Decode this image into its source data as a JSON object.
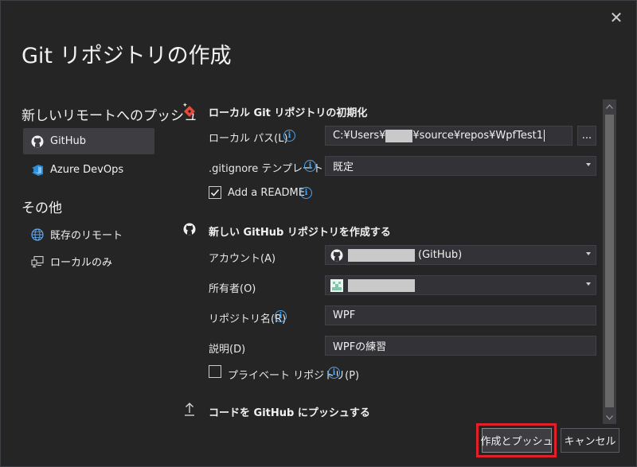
{
  "window": {
    "title": "Git リポジトリの作成",
    "close_glyph": "✕"
  },
  "sidebar": {
    "heading_push": "新しいリモートへのプッシュ",
    "items": [
      {
        "label": "GitHub",
        "icon": "github-icon",
        "selected": true
      },
      {
        "label": "Azure DevOps",
        "icon": "azure-devops-icon",
        "selected": false
      }
    ],
    "heading_other": "その他",
    "other_items": [
      {
        "label": "既存のリモート",
        "icon": "globe-icon"
      },
      {
        "label": "ローカルのみ",
        "icon": "computer-icon"
      }
    ]
  },
  "local_section": {
    "heading": "ローカル Git リポジトリの初期化",
    "path_label": "ローカル パス(L)",
    "path_prefix": "C:¥Users¥",
    "path_suffix": "¥source¥repos¥WpfTest1",
    "browse_label": "...",
    "gitignore_label": ".gitignore テンプレート",
    "gitignore_value": "既定",
    "readme_label": "Add a README",
    "readme_checked": true
  },
  "github_section": {
    "heading": "新しい GitHub リポジトリを作成する",
    "account_label": "アカウント(A)",
    "account_suffix": "(GitHub)",
    "owner_label": "所有者(O)",
    "repo_name_label": "リポジトリ名(R)",
    "repo_name_value": "WPF",
    "description_label": "説明(D)",
    "description_value": "WPFの練習",
    "private_label": "プライベート リポジトリ(P)",
    "private_checked": false
  },
  "push_section": {
    "heading": "コードを GitHub にプッシュする"
  },
  "footer": {
    "create_push_label": "作成とプッシュ",
    "cancel_label": "キャンセル"
  },
  "colors": {
    "background": "#252526",
    "field": "#333337",
    "accent_info": "#4ea3f1",
    "highlight_border": "#e0212b",
    "primary_button": "#3e3e42"
  }
}
